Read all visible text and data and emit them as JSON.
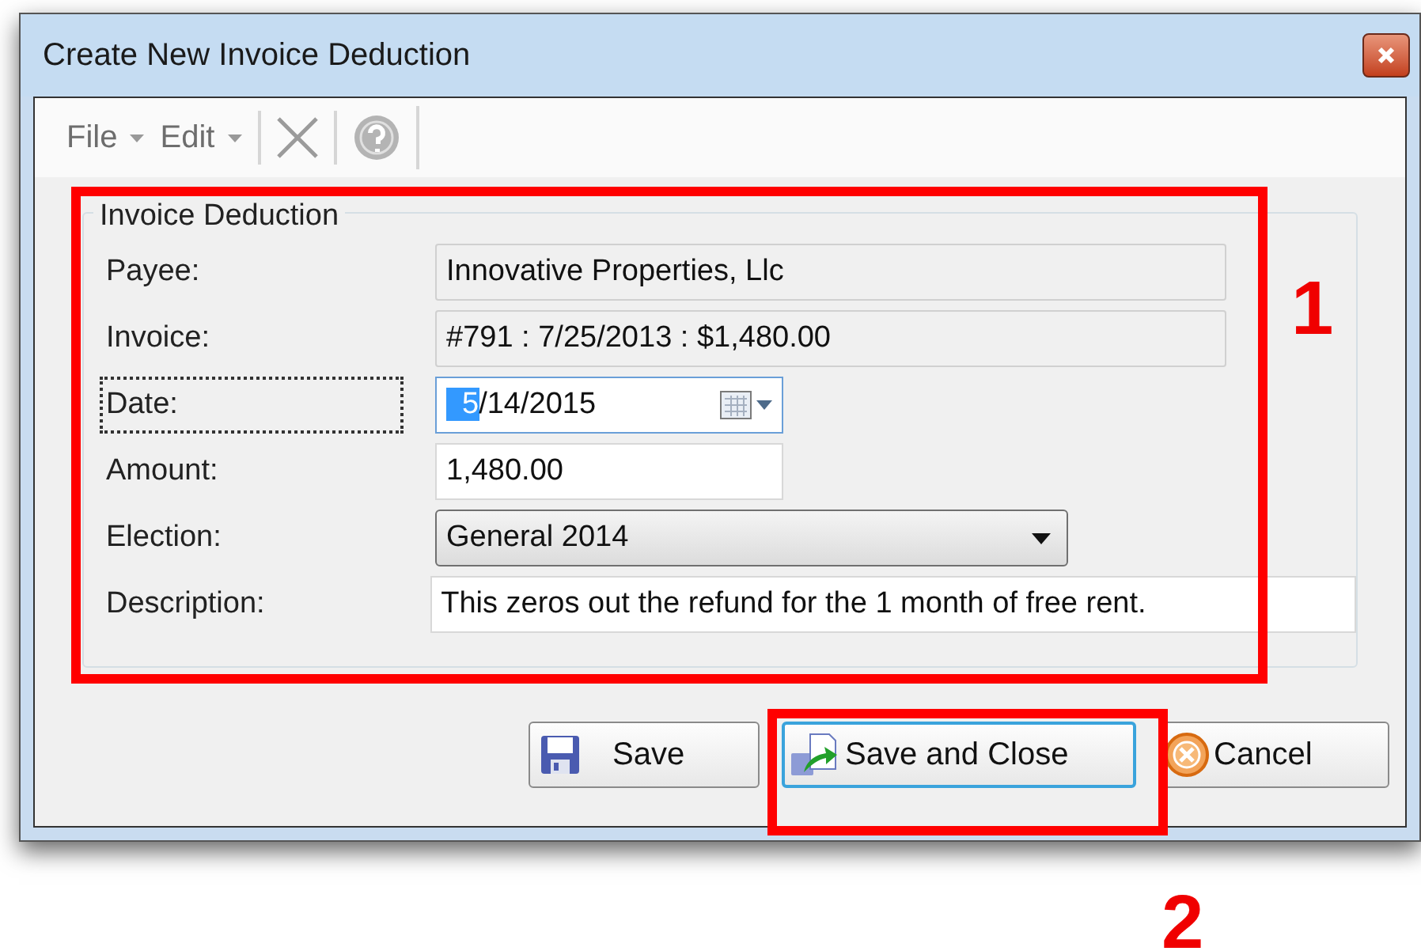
{
  "window": {
    "title": "Create New Invoice Deduction"
  },
  "toolbar": [
    {
      "kind": "menu",
      "label": "File"
    },
    {
      "kind": "menu",
      "label": "Edit"
    },
    {
      "kind": "delete",
      "disabled": true
    },
    {
      "kind": "help",
      "disabled": true
    }
  ],
  "group": {
    "title": "Invoice Deduction",
    "fields": [
      {
        "kind": "readonly",
        "label": "Payee:",
        "value": "Innovative Properties, Llc",
        "focused": false
      },
      {
        "kind": "readonly",
        "label": "Invoice:",
        "value": "#791 : 7/25/2013 : $1,480.00",
        "focused": false
      },
      {
        "kind": "date",
        "label": "Date:",
        "value_selected": "5",
        "value_rest": "/14/2015",
        "focused": true
      },
      {
        "kind": "text",
        "label": "Amount:",
        "value": "1,480.00",
        "focused": false
      },
      {
        "kind": "dropdown",
        "label": "Election:",
        "value": "General 2014",
        "focused": false
      },
      {
        "kind": "wide",
        "label": "Description:",
        "value": "This zeros out the refund for the 1 month of free rent.",
        "focused": false
      }
    ]
  },
  "buttons": [
    {
      "kind": "save",
      "label": "Save",
      "focused": false
    },
    {
      "kind": "save-close",
      "label": "Save and Close",
      "focused": true
    },
    {
      "kind": "cancel",
      "label": "Cancel",
      "focused": false
    }
  ],
  "callouts": [
    "1",
    "2"
  ]
}
